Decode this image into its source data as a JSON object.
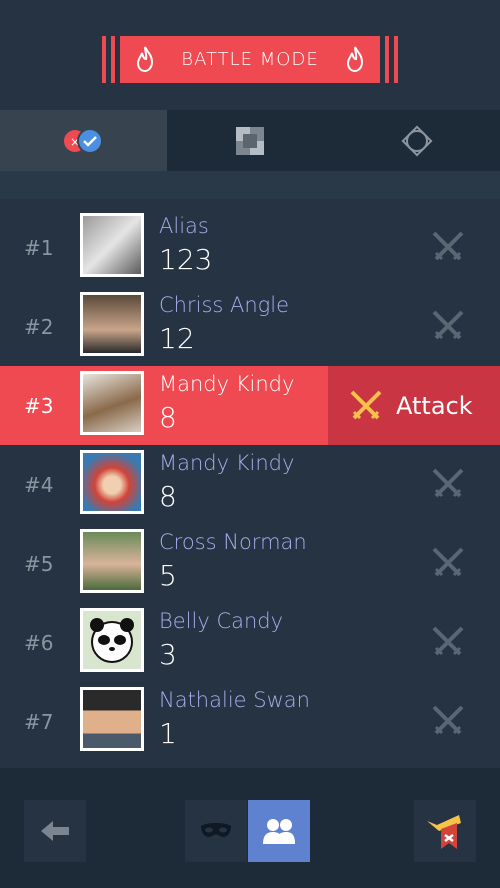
{
  "header": {
    "title": "BATTLE MODE",
    "accent": "#ef4a52"
  },
  "tabs": [
    {
      "id": "versus",
      "icon": "versus-badge-icon",
      "active": true
    },
    {
      "id": "grid",
      "icon": "pixel-grid-icon",
      "active": false
    },
    {
      "id": "shield",
      "icon": "crossed-shield-icon",
      "active": false
    }
  ],
  "players": [
    {
      "rank": "#1",
      "name": "Alias",
      "score": "123"
    },
    {
      "rank": "#2",
      "name": "Chriss Angle",
      "score": "12"
    },
    {
      "rank": "#3",
      "name": "Mandy Kindy",
      "score": "8",
      "highlighted": true
    },
    {
      "rank": "#4",
      "name": "Mandy Kindy",
      "score": "8"
    },
    {
      "rank": "#5",
      "name": "Cross Norman",
      "score": "5"
    },
    {
      "rank": "#6",
      "name": "Belly Candy",
      "score": "3"
    },
    {
      "rank": "#7",
      "name": "Nathalie Swan",
      "score": "1"
    }
  ],
  "attack": {
    "label": "Attack"
  },
  "footer": {
    "back_icon": "back-arrow-icon",
    "mask_icon": "mask-icon",
    "people_icon": "people-icon",
    "trumpet_icon": "trumpet-flag-icon"
  }
}
